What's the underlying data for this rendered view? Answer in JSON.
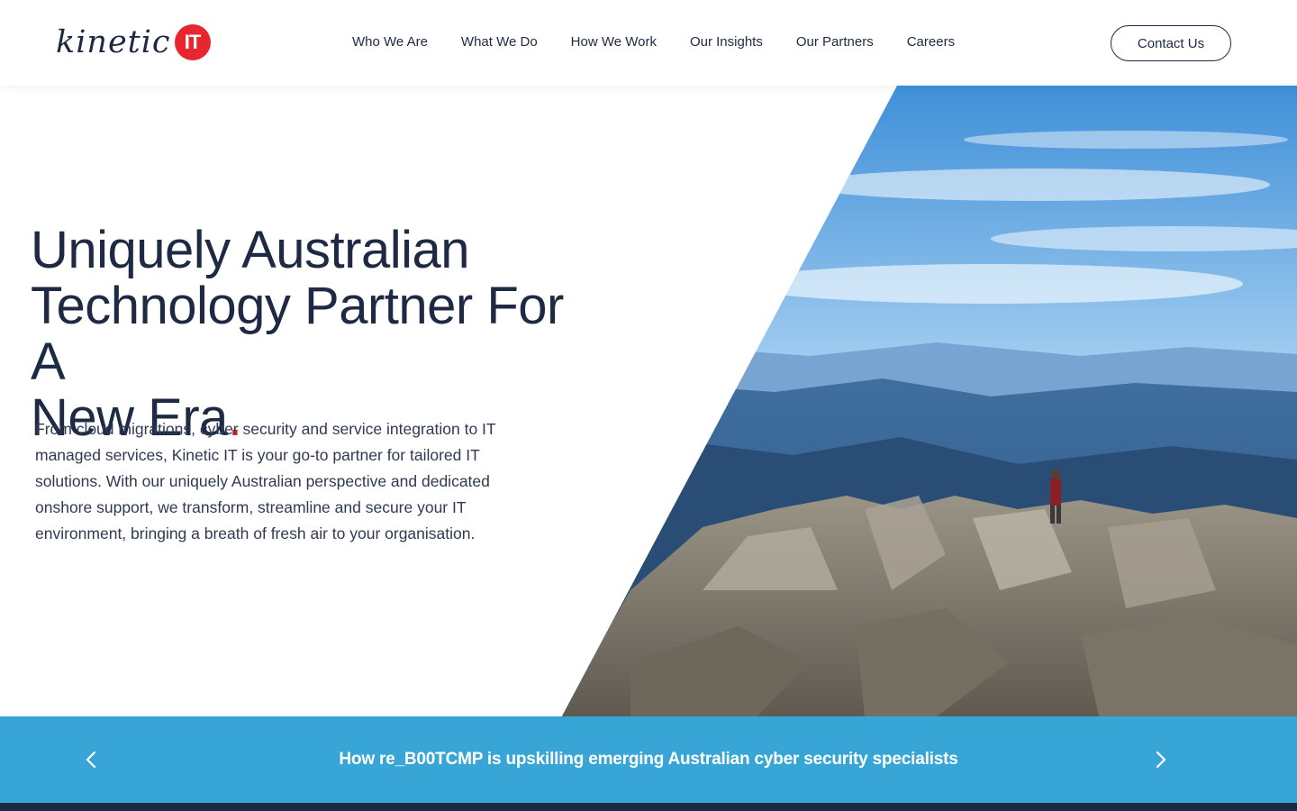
{
  "brand": {
    "logo_word": "kinetic",
    "logo_badge": "IT",
    "accent_color": "#e8262f",
    "navy_color": "#1e2a44",
    "banner_color": "#37a6d6"
  },
  "nav": {
    "items": [
      {
        "label": "Who We Are"
      },
      {
        "label": "What We Do"
      },
      {
        "label": "How We Work"
      },
      {
        "label": "Our Insights"
      },
      {
        "label": "Our Partners"
      },
      {
        "label": "Careers"
      }
    ],
    "contact_label": "Contact Us"
  },
  "hero": {
    "title_line1": "Uniquely Australian",
    "title_line2": "Technology Partner For A",
    "title_line3": "New Era",
    "title_dot": ".",
    "description": "From cloud migrations, cyber security and service integration to IT managed services, Kinetic IT is your go-to partner for tailored IT solutions. With our uniquely Australian perspective and dedicated onshore support, we transform, streamline and secure your IT environment, bringing a breath of fresh air to your organisation."
  },
  "banner": {
    "headline": "How re_B00TCMP is upskilling emerging Australian cyber security specialists",
    "prev_icon": "chevron-left-icon",
    "next_icon": "chevron-right-icon"
  }
}
